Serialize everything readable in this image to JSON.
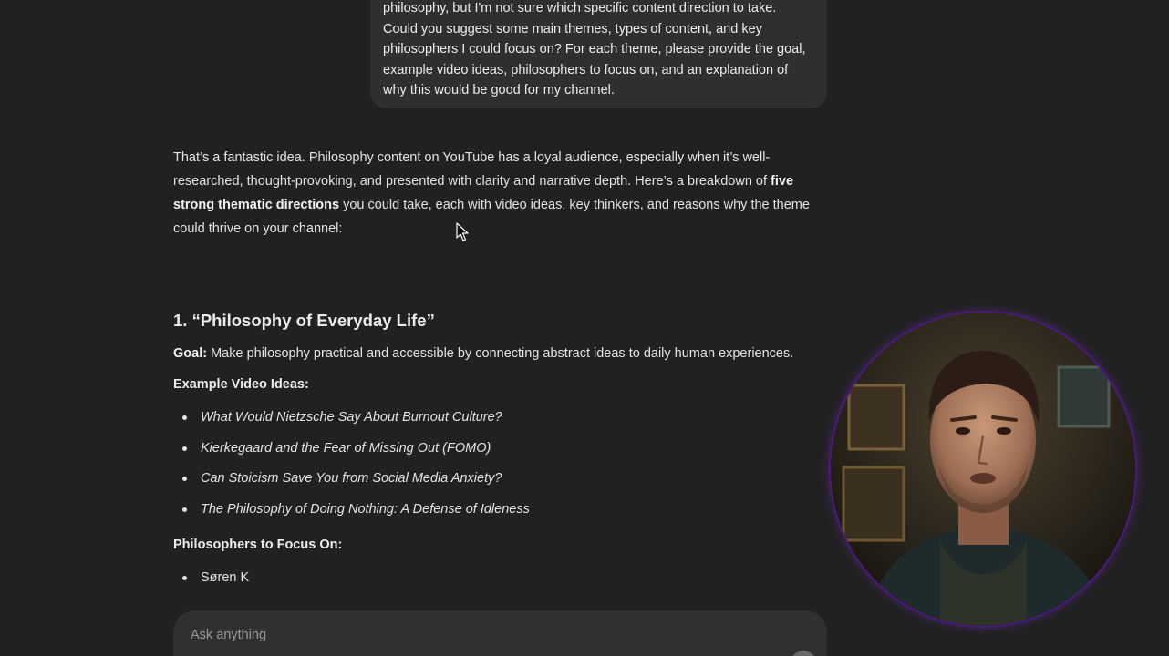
{
  "user_message": {
    "lines": [
      "philosophy, but I'm not sure which specific content direction to take.",
      "Could you suggest some main themes, types of content, and key",
      "philosophers I could focus on? For each theme, please provide the goal,",
      "example video ideas, philosophers to focus on, and an explanation of",
      "why this would be good for my channel."
    ]
  },
  "assistant": {
    "intro": {
      "part1": "That’s a fantastic idea. Philosophy content on YouTube has a loyal audience, especially when it’s well-researched, thought-provoking, and presented with clarity and narrative depth. Here’s a breakdown of ",
      "bold": "five strong thematic directions",
      "part2": " you could take, each with video ideas, key thinkers, and reasons why the theme could thrive on your channel:"
    },
    "section1": {
      "title": "1. “Philosophy of Everyday Life”",
      "goal_label": "Goal:",
      "goal_text": " Make philosophy practical and accessible by connecting abstract ideas to daily human experiences.",
      "ideas_heading": "Example Video Ideas:",
      "ideas": [
        "What Would Nietzsche Say About Burnout Culture?",
        "Kierkegaard and the Fear of Missing Out (FOMO)",
        "Can Stoicism Save You from Social Media Anxiety?",
        "The Philosophy of Doing Nothing: A Defense of Idleness"
      ],
      "philosophers_heading": "Philosophers to Focus On:",
      "philosophers": [
        "Søren K"
      ]
    }
  },
  "composer": {
    "placeholder": "Ask anything"
  },
  "colors": {
    "background": "#212121",
    "bubble": "#2f2f2f",
    "composer": "#303030",
    "webcam_ring": "#4b1a7a"
  }
}
